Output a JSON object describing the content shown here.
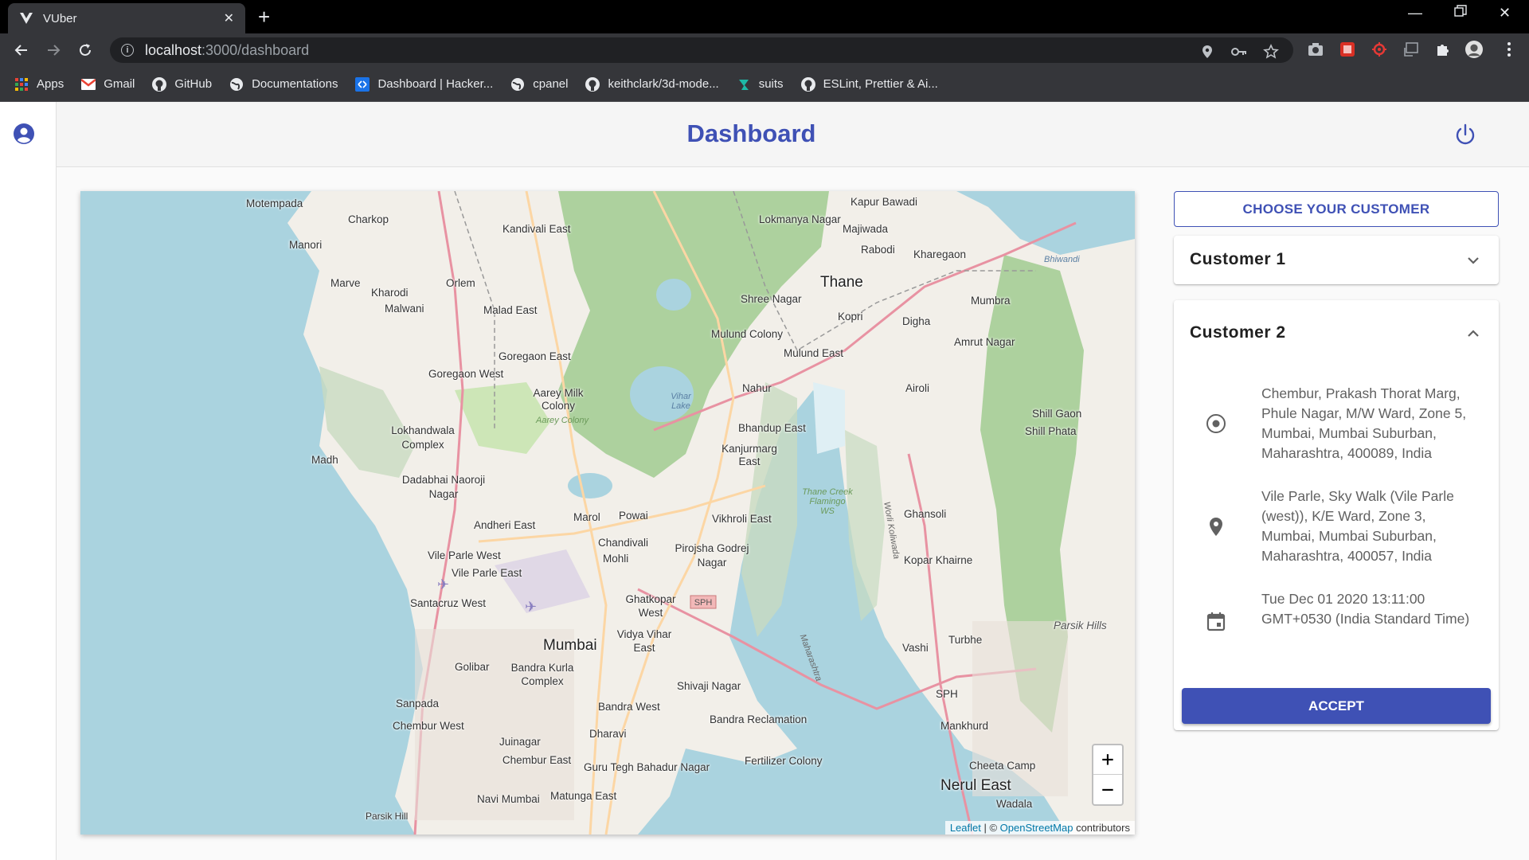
{
  "browser": {
    "tab_title": "VUber",
    "url_host": "localhost",
    "url_path": ":3000/dashboard",
    "bookmarks": [
      {
        "label": "Apps",
        "icon": "apps-grid-icon"
      },
      {
        "label": "Gmail",
        "icon": "gmail-icon"
      },
      {
        "label": "GitHub",
        "icon": "github-icon"
      },
      {
        "label": "Documentations",
        "icon": "globe-icon"
      },
      {
        "label": "Dashboard | Hacker...",
        "icon": "hackerrank-icon"
      },
      {
        "label": "cpanel",
        "icon": "globe-icon"
      },
      {
        "label": "keithclark/3d-mode...",
        "icon": "github-icon"
      },
      {
        "label": "suits",
        "icon": "suits-icon"
      },
      {
        "label": "ESLint, Prettier & Ai...",
        "icon": "github-icon"
      }
    ]
  },
  "header": {
    "title": "Dashboard"
  },
  "map": {
    "labels": [
      "Motempada",
      "Charkop",
      "Kandivali East",
      "Lokmanya Nagar",
      "Kapur Bawadi",
      "Majiwada",
      "Rabodi",
      "Kharegaon",
      "Bhiwandi",
      "Manori",
      "Marve",
      "Kharodi",
      "Orlem",
      "Malwani",
      "Malad East",
      "Shree Nagar",
      "Thane",
      "Kopri",
      "Mumbra",
      "Digha",
      "Mulund Colony",
      "Mulund East",
      "Amrut Nagar",
      "Goregaon East",
      "Goregaon West",
      "Aarey Milk Colony",
      "Aarey Colony",
      "Vihar Lake",
      "Nahur",
      "Airoli",
      "Bhandup East",
      "Shill Gaon",
      "Shill Phata",
      "Lokhandwala Complex",
      "Madh",
      "Kanjurmarg East",
      "Dadabhai Naoroji Nagar",
      "Thane Creek Flamingo WS",
      "Ghansoli",
      "Powai",
      "Andheri East",
      "Marol",
      "Vikhroli East",
      "Chandivali",
      "Mohli",
      "Pirojsha Godrej Nagar",
      "Vile Parle West",
      "Vile Parle East",
      "Kopar Khairne",
      "Santacruz West",
      "Ghatkopar West",
      "Vidya Vihar East",
      "Mumbai",
      "Parsik Hills",
      "Vashi",
      "Turbhe",
      "Golibar",
      "Bandra Kurla Complex",
      "Shivaji Nagar",
      "SPH",
      "Sanpada",
      "Bandra West",
      "Chembur West",
      "Bandra Reclamation",
      "Mankhurd",
      "Juinagar",
      "Dharavi",
      "Chembur East",
      "Guru Tegh Bahadur Nagar",
      "Fertilizer Colony",
      "Cheeta Camp",
      "Nerul East",
      "Navi Mumbai",
      "Matunga East",
      "Wadala",
      "Parsik Hill",
      "Worli Koliwada",
      "Maharashtra",
      "Thane"
    ],
    "zoom_in": "+",
    "zoom_out": "−",
    "attribution_leaflet": "Leaflet",
    "attribution_sep": " | © ",
    "attribution_osm": "OpenStreetMap",
    "attribution_tail": " contributors"
  },
  "panel": {
    "choose_label": "CHOOSE YOUR CUSTOMER",
    "customer1": {
      "title": "Customer 1"
    },
    "customer2": {
      "title": "Customer 2",
      "pickup": "Chembur, Prakash Thorat Marg, Phule Nagar, M/W Ward, Zone 5, Mumbai, Mumbai Suburban, Maharashtra, 400089, India",
      "drop": "Vile Parle, Sky Walk (Vile Parle (west)), K/E Ward, Zone 3, Mumbai, Mumbai Suburban, Maharashtra, 400057, India",
      "datetime": "Tue Dec 01 2020 13:11:00 GMT+0530 (India Standard Time)",
      "accept_label": "ACCEPT"
    }
  },
  "colors": {
    "primary": "#3f51b5",
    "water": "#aad3df",
    "land": "#f2efe9",
    "park": "#add19e"
  }
}
